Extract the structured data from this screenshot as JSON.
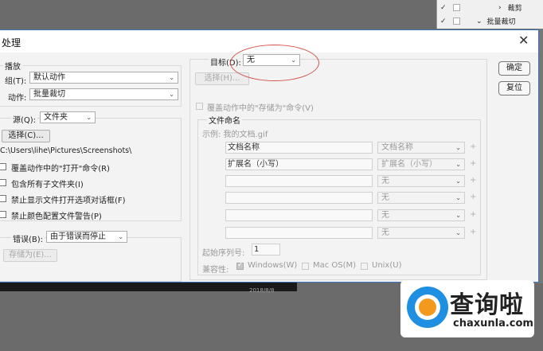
{
  "background": {
    "actions_panel": [
      {
        "expander": "›",
        "label": "裁剪"
      },
      {
        "expander": "⌄",
        "label": "批量裁切"
      }
    ],
    "date_text": "2018/8/8"
  },
  "dialog": {
    "title": "处理",
    "close_symbol": "✕",
    "play": {
      "section_label": "播放",
      "group_label": "组(T):",
      "group_value": "默认动作",
      "action_label": "动作:",
      "action_value": "批量裁切"
    },
    "source": {
      "label": "源(Q):",
      "value": "文件夹",
      "choose_button": "选择(C)...",
      "path": "C:\\Users\\lihe\\Pictures\\Screenshots\\",
      "options": [
        {
          "label": "覆盖动作中的\"打开\"命令(R)",
          "checked": false
        },
        {
          "label": "包含所有子文件夹(I)",
          "checked": false
        },
        {
          "label": "禁止显示文件打开选项对话框(F)",
          "checked": false
        },
        {
          "label": "禁止颜色配置文件警告(P)",
          "checked": false
        }
      ]
    },
    "errors": {
      "label": "错误(B):",
      "value": "由于错误而停止",
      "save_as_button": "存储为(E)..."
    },
    "destination": {
      "label": "目标(D):",
      "value": "无",
      "choose_button": "选择(H)...",
      "override_label": "覆盖动作中的\"存储为\"命令(V)"
    },
    "naming": {
      "section_label": "文件命名",
      "example": "示例: 我的文档.gif",
      "rows": [
        {
          "text": "文档名称",
          "select": "文档名称"
        },
        {
          "text": "扩展名（小写）",
          "select": "扩展名（小写）"
        },
        {
          "text": "",
          "select": "无"
        },
        {
          "text": "",
          "select": "无"
        },
        {
          "text": "",
          "select": "无"
        },
        {
          "text": "",
          "select": "无"
        }
      ],
      "plus_symbol": "+",
      "serial_label": "起始序列号:",
      "serial_value": "1",
      "compat_label": "兼容性:",
      "compat_options": [
        {
          "label": "Windows(W)",
          "checked": true
        },
        {
          "label": "Mac OS(M)",
          "checked": false
        },
        {
          "label": "Unix(U)",
          "checked": false
        }
      ]
    },
    "buttons": {
      "ok": "确定",
      "reset": "复位"
    }
  },
  "watermark": {
    "chinese": "查询啦",
    "latin": "chaxunla.com"
  }
}
